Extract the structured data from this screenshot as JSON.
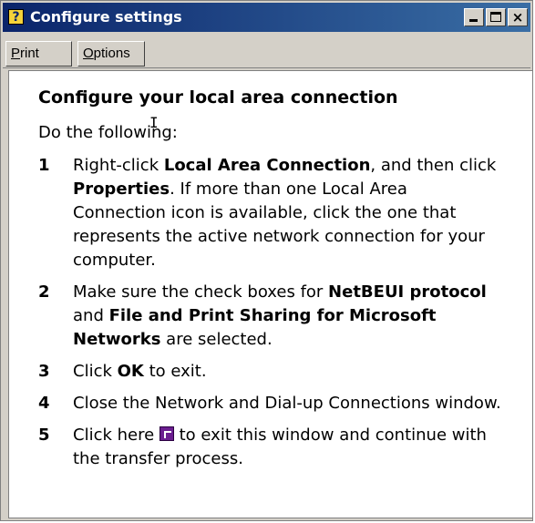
{
  "window": {
    "title": "Configure settings",
    "controls": {
      "minimize": "_",
      "maximize": "□",
      "close": "×"
    }
  },
  "toolbar": {
    "print_accel": "P",
    "print_rest": "rint",
    "options_accel": "O",
    "options_rest": "ptions"
  },
  "content": {
    "heading": "Configure your local area connection",
    "intro": "Do the following:",
    "cursor_glyph": "I",
    "steps": [
      {
        "num": "1",
        "t1": "Right-click ",
        "b1": "Local Area Connection",
        "t2": ", and then click ",
        "b2": "Properties",
        "t3": ".  If more than one Local Area Connection icon is available, click the one that represents the active network connection for your computer."
      },
      {
        "num": "2",
        "t1": "Make sure the check boxes for ",
        "b1": "NetBEUI protocol",
        "t2": " and ",
        "b2": "File and Print Sharing for Microsoft Networks",
        "t3": " are selected."
      },
      {
        "num": "3",
        "t1": "Click ",
        "b1": "OK",
        "t2": " to exit."
      },
      {
        "num": "4",
        "t1": "Close the Network and Dial-up Connections window."
      },
      {
        "num": "5",
        "t1": "Click here ",
        "t2": " to exit this window and continue with the transfer process."
      }
    ]
  },
  "icons": {
    "title_icon": "help-icon",
    "step5_icon": "exit-window-icon"
  },
  "colors": {
    "titlebar_start": "#0a246a",
    "titlebar_end": "#3a6ea5",
    "chrome": "#d4d0c8",
    "content_bg": "#ffffff",
    "exit_icon": "#6b1e90"
  }
}
